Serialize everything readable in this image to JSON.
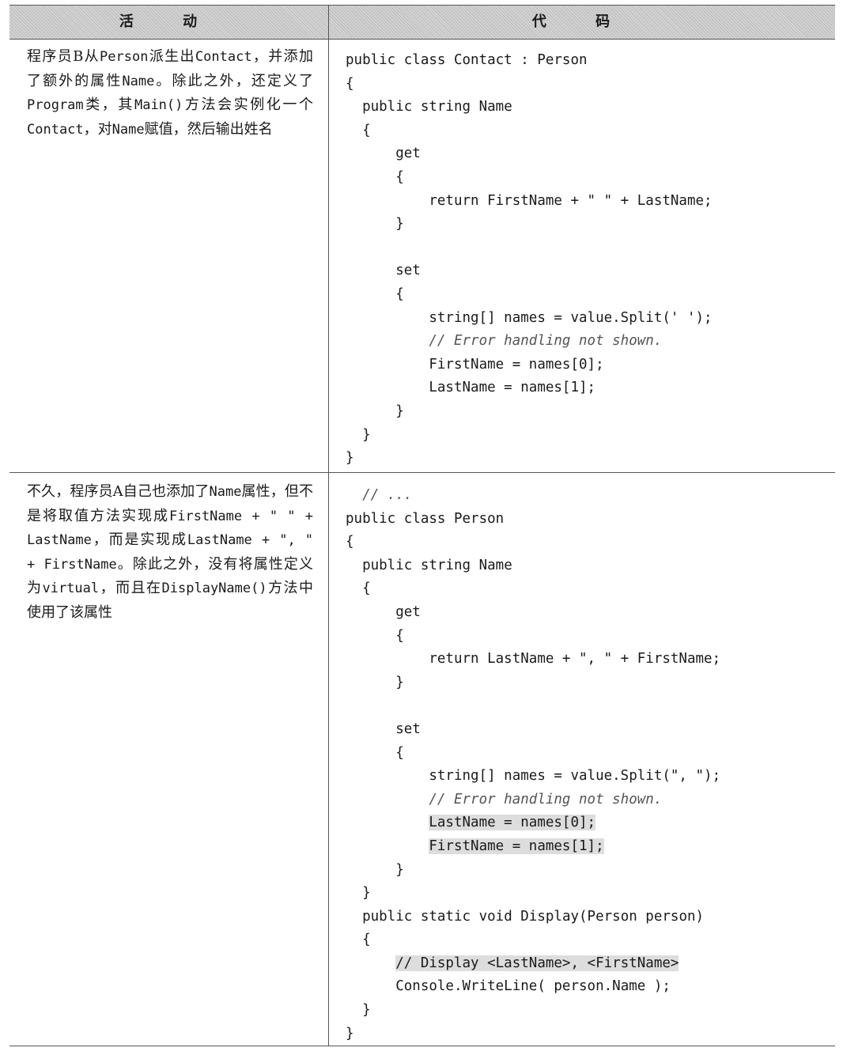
{
  "header": {
    "activity": "活 动",
    "code": "代 码"
  },
  "rows": [
    {
      "activity": [
        {
          "t": "程序员B从"
        },
        {
          "t": "Person",
          "m": true
        },
        {
          "t": "派生出"
        },
        {
          "t": "Contact",
          "m": true
        },
        {
          "t": "，并添加了额外的属性"
        },
        {
          "t": "Name",
          "m": true
        },
        {
          "t": "。除此之外，还定义了"
        },
        {
          "t": "Program",
          "m": true
        },
        {
          "t": "类，其"
        },
        {
          "t": "Main()",
          "m": true
        },
        {
          "t": "方法会实例化一个"
        },
        {
          "t": "Contact",
          "m": true
        },
        {
          "t": "，对"
        },
        {
          "t": "Name",
          "m": true
        },
        {
          "t": "赋值，然后输出姓名"
        }
      ],
      "code": [
        {
          "t": "public class Contact : Person"
        },
        {
          "t": "{"
        },
        {
          "t": "  public string Name"
        },
        {
          "t": "  {"
        },
        {
          "t": "      get"
        },
        {
          "t": "      {"
        },
        {
          "t": "          return FirstName + \" \" + LastName;"
        },
        {
          "t": "      }"
        },
        {
          "t": ""
        },
        {
          "t": "      set"
        },
        {
          "t": "      {"
        },
        {
          "t": "          string[] names = value.Split(' ');"
        },
        {
          "t": "          // Error handling not shown.",
          "c": true
        },
        {
          "t": "          FirstName = names[0];"
        },
        {
          "t": "          LastName = names[1];"
        },
        {
          "t": "      }"
        },
        {
          "t": "  }"
        },
        {
          "t": "}"
        }
      ]
    },
    {
      "activity": [
        {
          "t": "不久，程序员A自己也添加了"
        },
        {
          "t": "Name",
          "m": true
        },
        {
          "t": "属性，但不是将取值方法实现成"
        },
        {
          "t": "FirstName + \" \" + LastName",
          "m": true
        },
        {
          "t": "，而是实现成"
        },
        {
          "t": "LastName + \", \" + FirstName",
          "m": true
        },
        {
          "t": "。除此之外，没有将属性定义为"
        },
        {
          "t": "virtual",
          "m": true
        },
        {
          "t": "，而且在"
        },
        {
          "t": "DisplayName()",
          "m": true
        },
        {
          "t": "方法中使用了该属性"
        }
      ],
      "code": [
        {
          "t": "  // ...",
          "c": true
        },
        {
          "t": "public class Person"
        },
        {
          "t": "{"
        },
        {
          "t": "  public string Name"
        },
        {
          "t": "  {"
        },
        {
          "t": "      get"
        },
        {
          "t": "      {"
        },
        {
          "t": "          return LastName + \", \" + FirstName;"
        },
        {
          "t": "      }"
        },
        {
          "t": ""
        },
        {
          "t": "      set"
        },
        {
          "t": "      {"
        },
        {
          "t": "          string[] names = value.Split(\", \");"
        },
        {
          "t": "          // Error handling not shown.",
          "c": true
        },
        {
          "t": "          LastName = names[0];",
          "h": true
        },
        {
          "t": "          FirstName = names[1];",
          "h": true
        },
        {
          "t": "      }"
        },
        {
          "t": "  }"
        },
        {
          "t": "  public static void Display(Person person)"
        },
        {
          "t": "  {"
        },
        {
          "t": "      // Display <LastName>, <FirstName>",
          "h": true
        },
        {
          "t": "      Console.WriteLine( person.Name );"
        },
        {
          "t": "  }"
        },
        {
          "t": "}"
        }
      ]
    }
  ]
}
